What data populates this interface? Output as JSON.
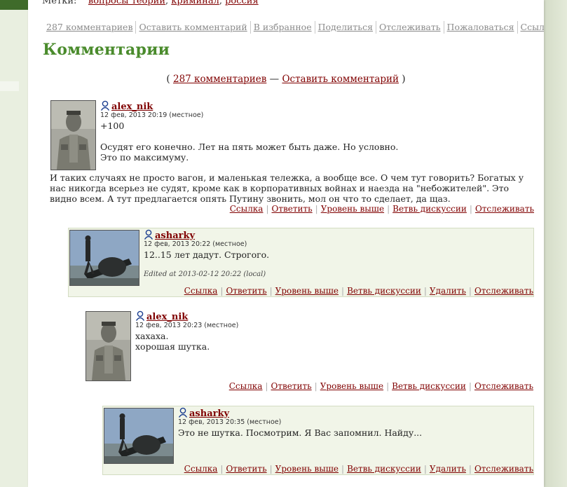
{
  "tags": {
    "label": "Метки:",
    "items": [
      "вопросы теории",
      "криминал",
      "россия"
    ]
  },
  "action_bar": {
    "comments_count": "287 комментариев",
    "leave_comment": "Оставить комментарий",
    "favorites": "В избранное",
    "share": "Поделиться",
    "track": "Отслеживать",
    "report": "Пожаловаться",
    "link": "Ссылка"
  },
  "section_title": "Комментарии",
  "summary": {
    "open": "(",
    "count": "287 комментариев",
    "dash": "—",
    "leave": "Оставить комментарий",
    "close": ")"
  },
  "comments": [
    {
      "user": "alex_nik",
      "date": "12 фев, 2013 20:19 (местное)",
      "lines": [
        "+100",
        "",
        "Осудят его конечно. Лет на пять может быть даже. Но условно.",
        "Это по максимуму."
      ],
      "wide_text": "И таких случаях не просто вагон, и маленькая тележка, а вообще все. О чем тут говорить? Богатых у нас никогда всерьез не судят, кроме как в корпоративных войнах и наезда на \"небожителей\". Это видно всем. А тут предлагается опять Путину звонить, мол он что то сделает, да щаз.",
      "links": [
        "Ссылка",
        "Ответить",
        "Уровень выше",
        "Ветвь дискуссии",
        "Отслеживать"
      ]
    },
    {
      "user": "asharky",
      "date": "12 фев, 2013 20:22 (местное)",
      "lines": [
        "12..15 лет дадут. Строгого."
      ],
      "edited": "Edited at 2013-02-12 20:22 (local)",
      "links": [
        "Ссылка",
        "Ответить",
        "Уровень выше",
        "Ветвь дискуссии",
        "Удалить",
        "Отслеживать"
      ]
    },
    {
      "user": "alex_nik",
      "date": "12 фев, 2013 20:23 (местное)",
      "lines": [
        "хахаха.",
        "хорошая шутка."
      ],
      "links": [
        "Ссылка",
        "Ответить",
        "Уровень выше",
        "Ветвь дискуссии",
        "Отслеживать"
      ]
    },
    {
      "user": "asharky",
      "date": "12 фев, 2013 20:35 (местное)",
      "lines": [
        "Это не шутка. Посмотрим. Я Вас запомнил. Найду..."
      ],
      "links": [
        "Ссылка",
        "Ответить",
        "Уровень выше",
        "Ветвь дискуссии",
        "Удалить",
        "Отслеживать"
      ]
    }
  ],
  "icons": {
    "user": "user-profile-icon",
    "avatar_old": "soldier-portrait-photo",
    "avatar_tank": "person-on-tank-photo"
  },
  "colors": {
    "link": "#800000",
    "title": "#4a8b2c",
    "alt_bg": "#f1f5e8",
    "page_bg": "#dfe8d4"
  }
}
